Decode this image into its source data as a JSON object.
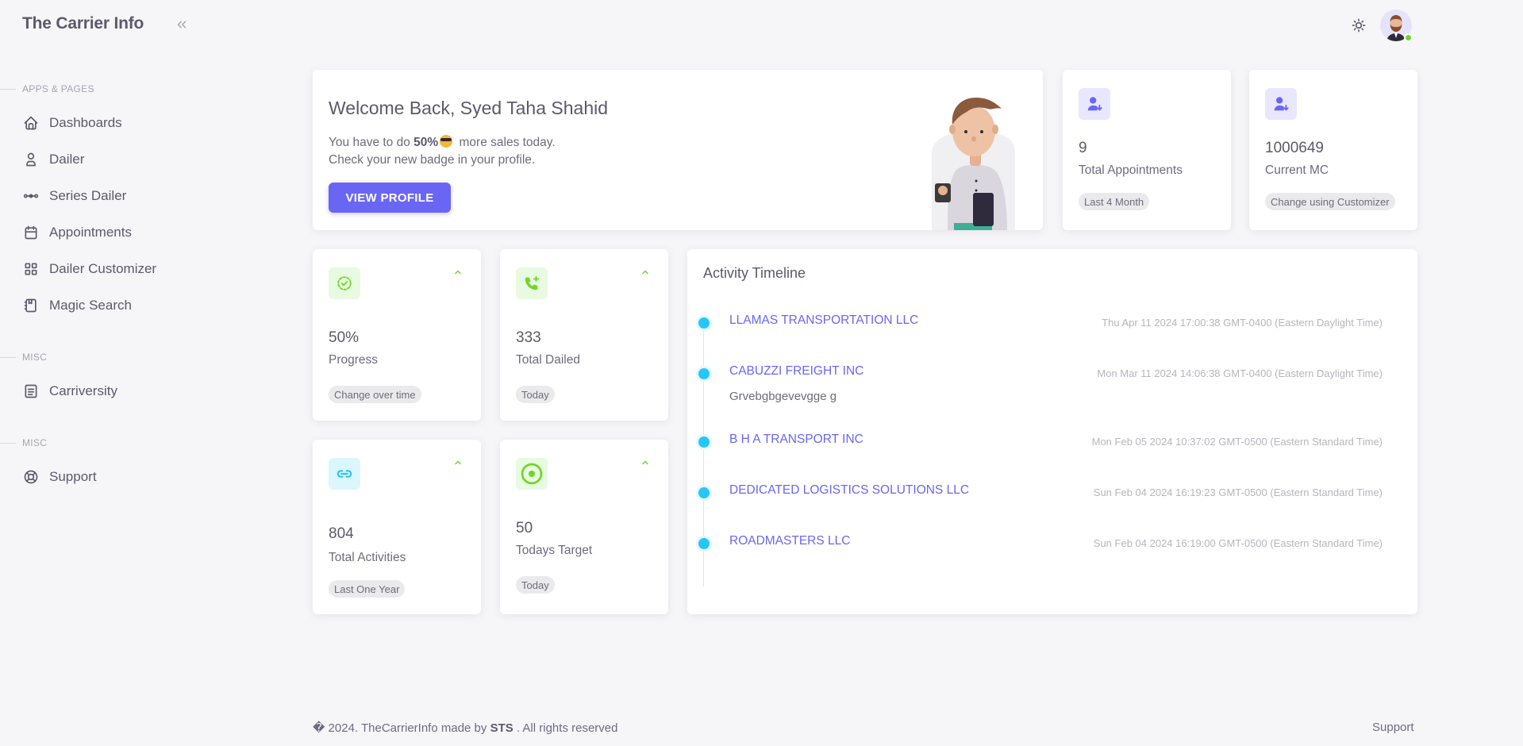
{
  "app": {
    "title": "The Carrier Info"
  },
  "sidebar": {
    "sections": [
      {
        "header": "APPS & PAGES",
        "items": [
          {
            "label": "Dashboards",
            "icon": "home-icon"
          },
          {
            "label": "Dailer",
            "icon": "user-icon"
          },
          {
            "label": "Series Dailer",
            "icon": "dots-connected-icon"
          },
          {
            "label": "Appointments",
            "icon": "calendar-icon"
          },
          {
            "label": "Dailer Customizer",
            "icon": "layout-grid-icon"
          },
          {
            "label": "Magic Search",
            "icon": "notebook-icon"
          }
        ]
      },
      {
        "header": "MISC",
        "items": [
          {
            "label": "Carriversity",
            "icon": "article-icon"
          }
        ]
      },
      {
        "header": "MISC",
        "items": [
          {
            "label": "Support",
            "icon": "lifebuoy-icon"
          }
        ]
      }
    ]
  },
  "header": {
    "theme_icon": "sun-icon",
    "user_status": "online"
  },
  "welcome": {
    "title": "Welcome Back, Syed Taha Shahid",
    "line1_prefix": "You have to do",
    "line1_highlight": "50%",
    "line1_emoji": "smiling-face-with-sunglasses",
    "line1_suffix": "more sales today.",
    "line2": "Check your new badge in your profile.",
    "button_label": "VIEW PROFILE"
  },
  "top_stats": [
    {
      "value": "9",
      "label": "Total Appointments",
      "chip": "Last 4 Month",
      "icon": "user-download-icon"
    },
    {
      "value": "1000649",
      "label": "Current MC",
      "chip": "Change using Customizer",
      "icon": "user-download-icon"
    }
  ],
  "small_stats": [
    {
      "value": "50%",
      "label": "Progress",
      "chip": "Change over time",
      "icon": "circle-check-dashed-icon",
      "color": "#6dd62a"
    },
    {
      "value": "333",
      "label": "Total Dailed",
      "chip": "Today",
      "icon": "phone-plus-icon",
      "color": "#6dd62a"
    },
    {
      "value": "804",
      "label": "Total Activities",
      "chip": "Last One Year",
      "icon": "link-icon",
      "color": "#26c6f9"
    },
    {
      "value": "50",
      "label": "Todays Target",
      "chip": "Today",
      "icon": "target-icon",
      "color": "#6dd62a"
    }
  ],
  "timeline": {
    "title": "Activity Timeline",
    "items": [
      {
        "title": "LLAMAS TRANSPORTATION LLC",
        "time": "Thu Apr 11 2024 17:00:38 GMT-0400 (Eastern Daylight Time)",
        "description": ""
      },
      {
        "title": "CABUZZI FREIGHT INC",
        "time": "Mon Mar 11 2024 14:06:38 GMT-0400 (Eastern Daylight Time)",
        "description": "Grvebgbgevevgge g"
      },
      {
        "title": "B H A TRANSPORT INC",
        "time": "Mon Feb 05 2024 10:37:02 GMT-0500 (Eastern Standard Time)",
        "description": ""
      },
      {
        "title": "DEDICATED LOGISTICS SOLUTIONS LLC",
        "time": "Sun Feb 04 2024 16:19:23 GMT-0500 (Eastern Standard Time)",
        "description": ""
      },
      {
        "title": "ROADMASTERS LLC",
        "time": "Sun Feb 04 2024 16:19:00 GMT-0500 (Eastern Standard Time)",
        "description": ""
      }
    ]
  },
  "footer": {
    "prefix": "� 2024. TheCarrierInfo made by",
    "brand": "STS",
    "suffix": ". All rights reserved",
    "support_link": "Support"
  },
  "colors": {
    "primary": "#6a66f4",
    "success": "#6dd62a",
    "info": "#26c6f9",
    "text": "#5d596c",
    "background": "#f6f6f9"
  }
}
